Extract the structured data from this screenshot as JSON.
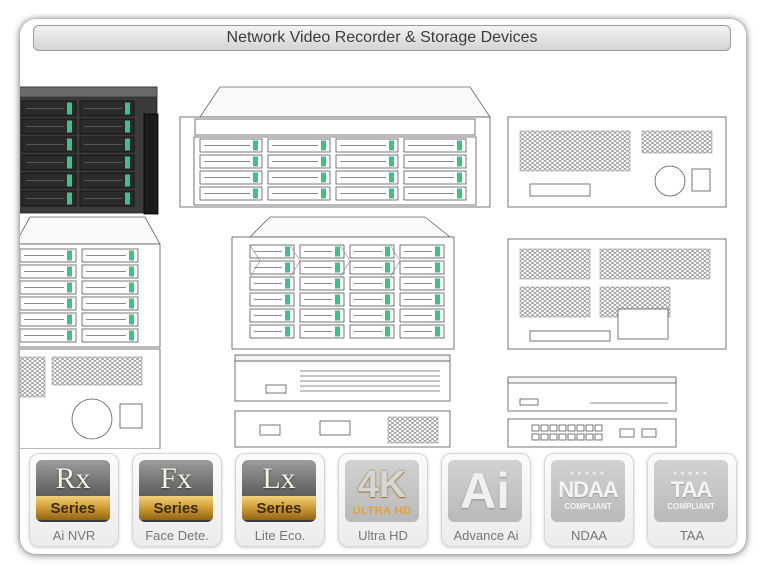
{
  "header": {
    "title": "Network Video Recorder & Storage Devices"
  },
  "badges": [
    {
      "name": "rx",
      "letters": "Rx",
      "series": "Series",
      "caption": "Ai NVR"
    },
    {
      "name": "fx",
      "letters": "Fx",
      "series": "Series",
      "caption": "Face Dete."
    },
    {
      "name": "lx",
      "letters": "Lx",
      "series": "Series",
      "caption": "Lite Eco."
    },
    {
      "name": "4k",
      "big": "4K",
      "sub": "ULTRA HD",
      "caption": "Ultra HD"
    },
    {
      "name": "ai",
      "big": "Ai",
      "caption": "Advance Ai"
    },
    {
      "name": "ndaa",
      "stars": "★★★★★",
      "big": "NDAA",
      "sub": "COMPLIANT",
      "caption": "NDAA"
    },
    {
      "name": "taa",
      "stars": "★★★★★",
      "big": "TAA",
      "sub": "COMPLIANT",
      "caption": "TAA"
    }
  ],
  "colors": {
    "bay_accent": "#3fbf8a",
    "frame_border": "#9a9a9a",
    "gold": "#c9962e"
  }
}
